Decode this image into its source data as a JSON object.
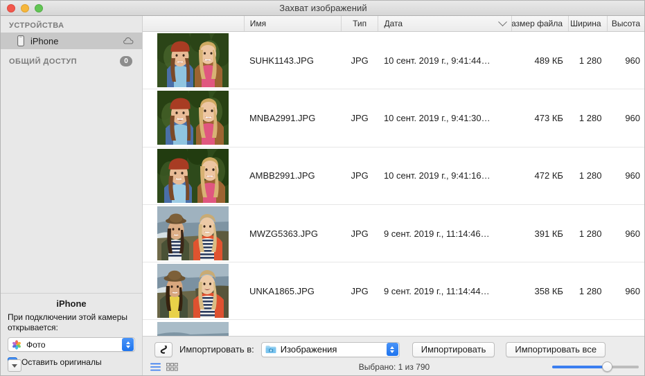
{
  "window": {
    "title": "Захват изображений",
    "traffic_lights": [
      "close",
      "minimize",
      "zoom"
    ]
  },
  "sidebar": {
    "sections": [
      {
        "title": "УСТРОЙСТВА",
        "badge": null
      },
      {
        "title": "ОБЩИЙ ДОСТУП",
        "badge": "0"
      }
    ],
    "devices": [
      {
        "label": "iPhone",
        "selected": true,
        "icon": "iphone-icon",
        "trailing_icon": "cloud-icon"
      }
    ],
    "info": {
      "device_name": "iPhone",
      "description": "При подключении этой камеры открывается:",
      "app_popup_value": "Фото",
      "app_popup_icon": "photos-app-icon",
      "checkbox_label": "Оставить оригиналы",
      "checkbox_checked": true,
      "disclosure_icon": "disclosure-triangle-icon"
    }
  },
  "table": {
    "columns": [
      {
        "key": "thumb",
        "label": "",
        "align": "center"
      },
      {
        "key": "name",
        "label": "Имя",
        "align": "left"
      },
      {
        "key": "type",
        "label": "Тип",
        "align": "center"
      },
      {
        "key": "date",
        "label": "Дата",
        "align": "left",
        "sorted": true,
        "sort_icon": "chevron-down-icon"
      },
      {
        "key": "size",
        "label": "Размер файла",
        "align": "right"
      },
      {
        "key": "width",
        "label": "Ширина",
        "align": "right"
      },
      {
        "key": "height",
        "label": "Высота",
        "align": "right"
      }
    ],
    "rows": [
      {
        "name": "SUHK1143.JPG",
        "type": "JPG",
        "date": "10 сент. 2019 г., 9:41:44…",
        "size": "489 КБ",
        "width": "1 280",
        "height": "960",
        "scene": "forest"
      },
      {
        "name": "MNBA2991.JPG",
        "type": "JPG",
        "date": "10 сент. 2019 г., 9:41:30…",
        "size": "473 КБ",
        "width": "1 280",
        "height": "960",
        "scene": "forest"
      },
      {
        "name": "AMBB2991.JPG",
        "type": "JPG",
        "date": "10 сент. 2019 г., 9:41:16…",
        "size": "472 КБ",
        "width": "1 280",
        "height": "960",
        "scene": "forest"
      },
      {
        "name": "MWZG5363.JPG",
        "type": "JPG",
        "date": "9 сент. 2019 г., 11:14:46…",
        "size": "391 КБ",
        "width": "1 280",
        "height": "960",
        "scene": "coast"
      },
      {
        "name": "UNKA1865.JPG",
        "type": "JPG",
        "date": "9 сент. 2019 г., 11:14:44…",
        "size": "358 КБ",
        "width": "1 280",
        "height": "960",
        "scene": "coast"
      },
      {
        "name": "",
        "type": "",
        "date": "",
        "size": "",
        "width": "",
        "height": "",
        "scene": "coast"
      }
    ]
  },
  "bottom_bar": {
    "rotate_icon": "rotate-left-icon",
    "import_to_label": "Импортировать в:",
    "destination": "Изображения",
    "destination_icon": "pictures-folder-icon",
    "import_button": "Импортировать",
    "import_all_button": "Импортировать все",
    "status": "Выбрано: 1 из 790",
    "view_list_icon": "list-view-icon",
    "view_grid_icon": "grid-view-icon",
    "view_active": "list",
    "thumbnail_size_value": 58
  },
  "colors": {
    "accent": "#3b7ef0",
    "sidebar_bg": "#e8e8e8",
    "selected_row": "#c8c8c8",
    "badge_bg": "#8d8d8d",
    "titlebar_text": "#3b3b3b"
  }
}
